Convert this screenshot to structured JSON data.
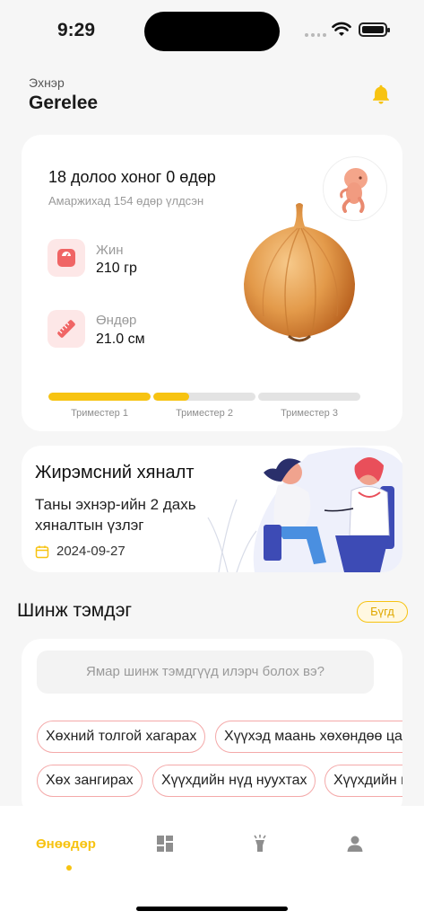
{
  "status_bar": {
    "time": "9:29"
  },
  "header": {
    "subtitle": "Эхнэр",
    "name": "Gerelee"
  },
  "pregnancy": {
    "week_text": "18 долоо хоног 0 өдөр",
    "days_left": "Амаржихад 154 өдөр үлдсэн",
    "weight": {
      "label": "Жин",
      "value": "210 гр"
    },
    "height": {
      "label": "Өндөр",
      "value": "21.0 см"
    },
    "fruit_icon": "onion-image",
    "trimesters": [
      {
        "label": "Триместер 1",
        "progress": 1.0
      },
      {
        "label": "Триместер 2",
        "progress": 0.35
      },
      {
        "label": "Триместер 3",
        "progress": 0.0
      }
    ]
  },
  "monitoring": {
    "title": "Жирэмсний хяналт",
    "description": "Таны эхнэр-ийн 2 дахь хяналтын үзлэг",
    "date": "2024-09-27"
  },
  "symptoms": {
    "title": "Шинж тэмдэг",
    "all_label": "Бүгд",
    "search_placeholder": "Ямар шинж тэмдгүүд илэрч болох вэ?",
    "chips_row1": [
      "Хөхний толгой хагарах",
      "Хүүхэд маань хөхөндөө цадаж байна уу"
    ],
    "chips_row2": [
      "Хөх зангирах",
      "Хүүхдийн нүд нуухтах",
      "Хүүхдийн нөх"
    ]
  },
  "nav": {
    "today_label": "Өнөөдөр",
    "items": [
      "dashboard-icon",
      "tips-icon",
      "profile-icon"
    ],
    "accent": "#f7c311"
  }
}
